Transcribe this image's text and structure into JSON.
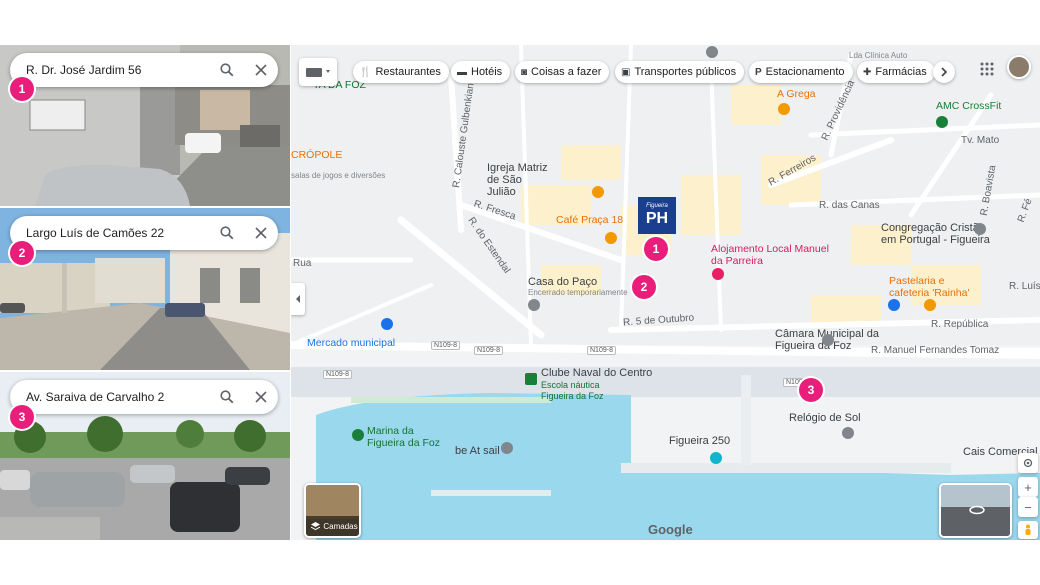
{
  "street_views": [
    {
      "number": "1",
      "address": "R. Dr. José Jardim 56"
    },
    {
      "number": "2",
      "address": "Largo Luís de Camões 22"
    },
    {
      "number": "3",
      "address": "Av. Saraiva de Carvalho 2"
    }
  ],
  "toolbar": {
    "chips": [
      {
        "icon": "restaurant-icon",
        "label": "Restaurantes"
      },
      {
        "icon": "hotel-icon",
        "label": "Hotéis"
      },
      {
        "icon": "camera-icon",
        "label": "Coisas a fazer"
      },
      {
        "icon": "transit-icon",
        "label": "Transportes públicos"
      },
      {
        "icon": "parking-icon",
        "label": "Estacionamento"
      },
      {
        "icon": "pharmacy-icon",
        "label": "Farmácias"
      }
    ]
  },
  "map": {
    "streets": {
      "r_fresca": "R. Fresca",
      "r_estendal": "R. do Estendal",
      "r_calouste": "R. Calouste Gulbenkian",
      "r_5_outubro": "R. 5 de Outubro",
      "r_republica": "R. República",
      "r_manuel": "R. Manuel Fernandes Tomaz",
      "r_ferreiros": "R. Ferreiros",
      "r_canas": "R. das Canas",
      "r_boavista": "R. Boavista",
      "r_providencia": "R. Providência",
      "tv_mato": "Tv. Mato",
      "r_luis": "R. Luís",
      "r_fe": "R. Fé",
      "rua": "Rua",
      "n109": "N109-8"
    },
    "places": {
      "igreja": "Igreja Matriz de São Julião",
      "cafe": "Café Praça 18",
      "alojamento": "Alojamento Local Manuel da Parreira",
      "casa_paco": "Casa do Paço",
      "casa_paco_sub": "Encerrado temporariamente",
      "mercado": "Mercado municipal",
      "clube": "Clube Naval do Centro",
      "escola": "Escola náutica Figueira da Foz",
      "marina": "Marina da Figueira da Foz",
      "be_at_sail": "be At sail",
      "figueira250": "Figueira 250",
      "relogio": "Relógio de Sol",
      "camara": "Câmara Municipal da Figueira da Foz",
      "congregacao": "Congregação Cristã em Portugal - Figueira",
      "pastelaria": "Pastelaria e cafeteria 'Rainha'",
      "a_grega": "A Grega",
      "amc": "AMC CrossFit",
      "cais": "Cais Comercial",
      "cropole": "CRÓPOLE",
      "jogos": "salas de jogos e diversões",
      "praia": "TA DA FOZ",
      "clinica": "Lda Clínica Auto",
      "hotel_brand": "PH",
      "hotel_brand_small": "Figueira"
    },
    "pins": [
      "1",
      "2",
      "3"
    ],
    "layers_label": "Camadas",
    "google": "Google"
  },
  "colors": {
    "pin": "#e91e7a",
    "water": "#9ad8ee",
    "hotel": "#1a3f8f"
  }
}
